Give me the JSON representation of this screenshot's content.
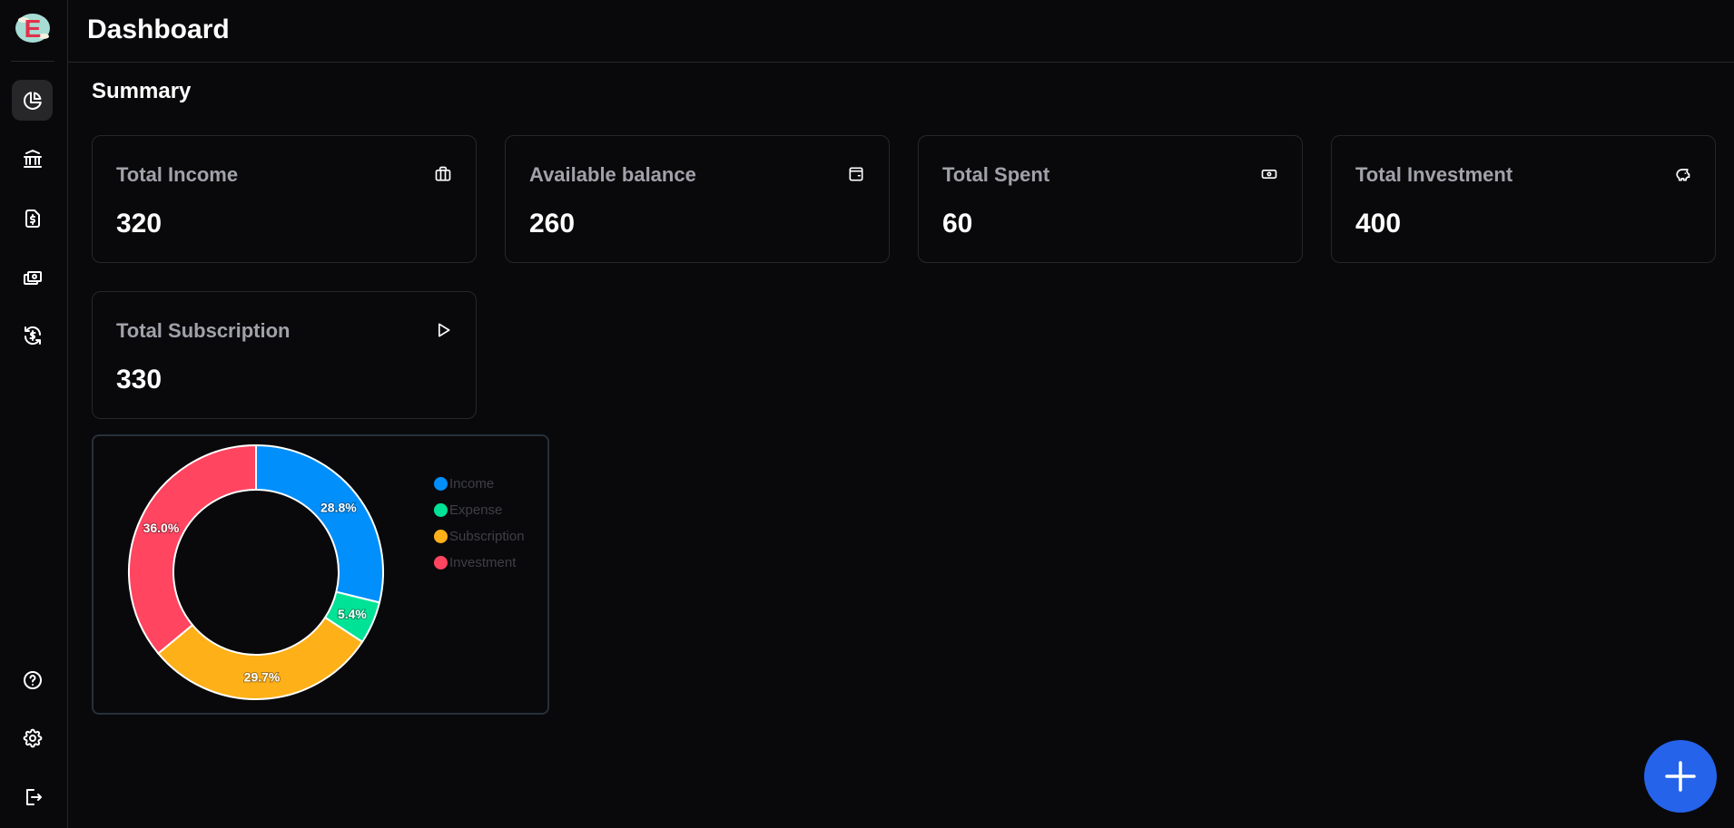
{
  "header": {
    "title": "Dashboard"
  },
  "sidebar": {
    "logo_letter": "E",
    "items": [
      {
        "icon": "chart-pie-icon",
        "active": true
      },
      {
        "icon": "bank-icon"
      },
      {
        "icon": "file-dollar-icon"
      },
      {
        "icon": "cash-icon"
      },
      {
        "icon": "recurring-dollar-icon"
      }
    ],
    "bottom": [
      {
        "icon": "help-icon"
      },
      {
        "icon": "settings-icon"
      },
      {
        "icon": "logout-icon"
      }
    ]
  },
  "main": {
    "section_title": "Summary",
    "cards": [
      {
        "label": "Total Income",
        "value": "320",
        "icon": "briefcase-icon"
      },
      {
        "label": "Available balance",
        "value": "260",
        "icon": "wallet-icon"
      },
      {
        "label": "Total Spent",
        "value": "60",
        "icon": "cash-icon"
      },
      {
        "label": "Total Investment",
        "value": "400",
        "icon": "piggy-bank-icon"
      },
      {
        "label": "Total Subscription",
        "value": "330",
        "icon": "play-icon"
      }
    ]
  },
  "chart_data": {
    "type": "pie",
    "donut": true,
    "categories": [
      "Income",
      "Expense",
      "Subscription",
      "Investment"
    ],
    "values": [
      320,
      60,
      330,
      400
    ],
    "data_labels": [
      "28.8%",
      "5.4%",
      "29.7%",
      "36.0%"
    ],
    "colors": [
      "#008ffb",
      "#00e396",
      "#feb019",
      "#ff4560"
    ],
    "legend": "right"
  },
  "fab": {
    "icon": "plus-icon"
  }
}
